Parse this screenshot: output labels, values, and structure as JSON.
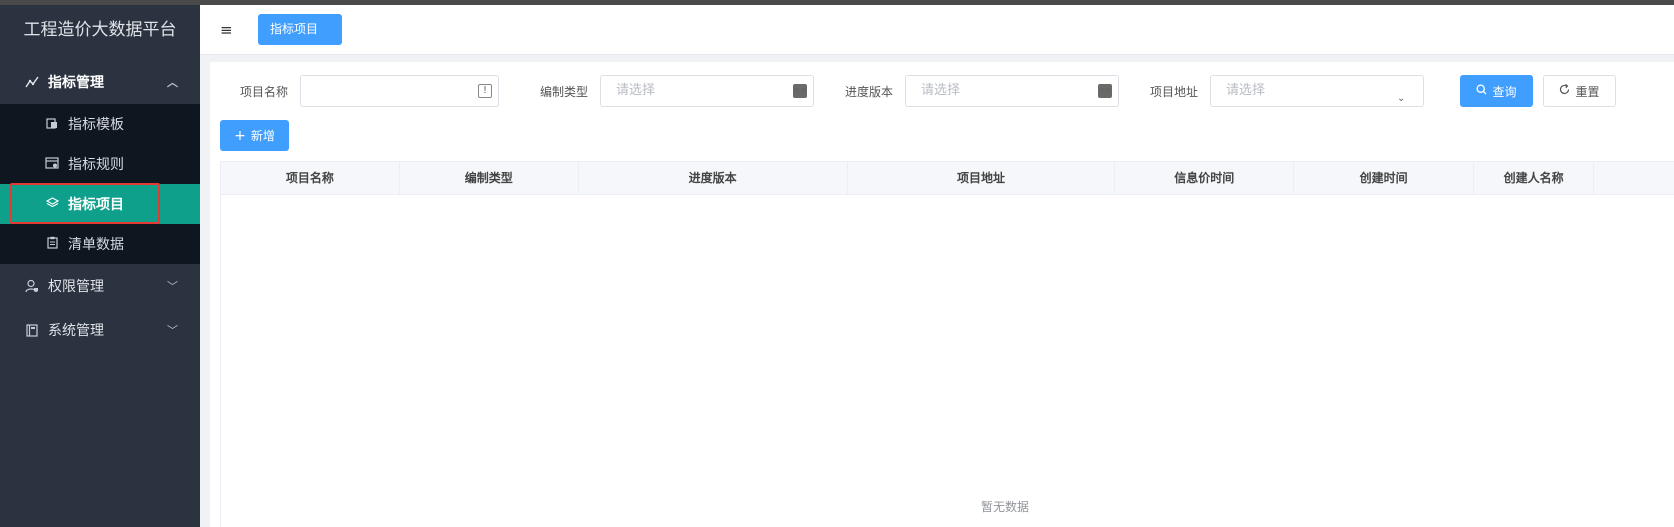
{
  "sidebar": {
    "brand": "工程造价大数据平台",
    "groups": [
      {
        "label": "指标管理",
        "icon": "chart-icon",
        "expanded": true,
        "items": [
          {
            "label": "指标模板",
            "icon": "template-icon"
          },
          {
            "label": "指标规则",
            "icon": "rule-icon"
          },
          {
            "label": "指标项目",
            "icon": "layers-icon",
            "active": true
          },
          {
            "label": "清单数据",
            "icon": "clipboard-icon"
          }
        ]
      },
      {
        "label": "权限管理",
        "icon": "user-lock-icon",
        "expanded": false
      },
      {
        "label": "系统管理",
        "icon": "book-icon",
        "expanded": false
      }
    ]
  },
  "header": {
    "tab_label": "指标项目"
  },
  "filters": {
    "project_name_label": "项目名称",
    "project_name_value": "",
    "compile_type_label": "编制类型",
    "compile_type_placeholder": "请选择",
    "progress_version_label": "进度版本",
    "progress_version_placeholder": "请选择",
    "project_address_label": "项目地址",
    "project_address_placeholder": "请选择",
    "query_label": "查询",
    "reset_label": "重置"
  },
  "actions": {
    "add_label": "新增"
  },
  "table": {
    "columns": [
      "项目名称",
      "编制类型",
      "进度版本",
      "项目地址",
      "信息价时间",
      "创建时间",
      "创建人名称"
    ],
    "rows": [],
    "empty_text": "暂无数据"
  },
  "colors": {
    "sidebar_bg": "#2b3340",
    "submenu_bg": "#0e1620",
    "active_item": "#0fa08c",
    "primary": "#409eff",
    "highlight_border": "#e53935"
  }
}
